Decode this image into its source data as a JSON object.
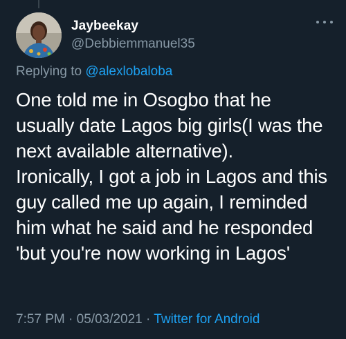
{
  "tweet": {
    "display_name": "Jaybeekay",
    "handle": "@Debbiemmanuel35",
    "replying_prefix": "Replying to ",
    "replying_to": "@alexlobaloba",
    "text": "One told me in Osogbo that he\nusually date Lagos big girls(I was the\nnext available alternative).\nIronically, I got a job in Lagos and this\nguy called me up again, I reminded\nhim what he said and he responded\n'but you're now working in Lagos'",
    "time": "7:57 PM",
    "date": "05/03/2021",
    "separator": "·",
    "source": "Twitter for Android"
  },
  "icons": {
    "more": "more-horizontal-icon",
    "avatar": "user-avatar"
  },
  "colors": {
    "background": "#15202b",
    "primary_text": "#ffffff",
    "secondary_text": "#8899a6",
    "accent": "#1da1f2"
  }
}
